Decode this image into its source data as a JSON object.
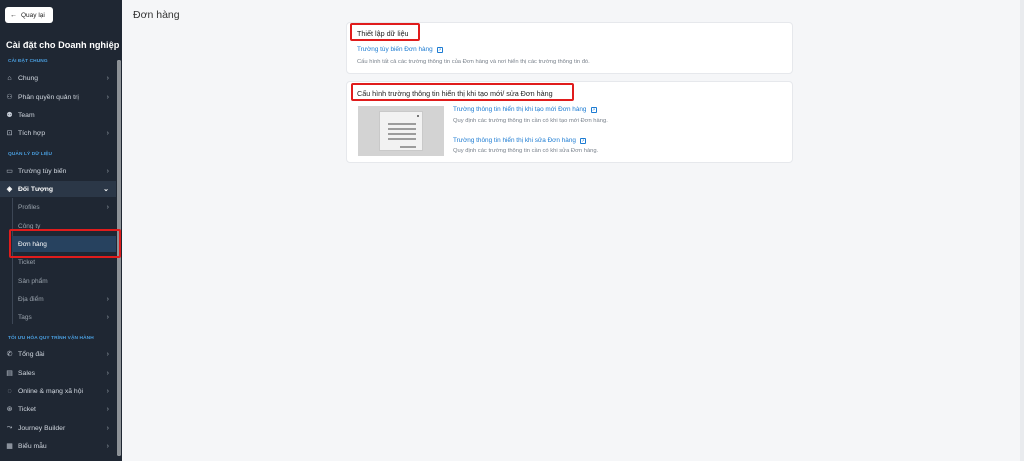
{
  "sidebar": {
    "back_label": "Quay lại",
    "title": "Cài đặt cho Doanh nghiệp",
    "section_general": "CÀI ĐẶT CHUNG",
    "section_data": "QUẢN LÝ DỮ LIỆU",
    "section_workflow": "TỐI ƯU HÓA QUY TRÌNH VẬN HÀNH",
    "items": {
      "chung": "Chung",
      "phan_quyen": "Phân quyền quản trị",
      "team": "Team",
      "tich_hop": "Tích hợp",
      "truong_tuy_bien": "Trường tùy biến",
      "doi_tuong": "Đối Tượng",
      "tong_dai": "Tổng đài",
      "sales": "Sales",
      "online": "Online & mạng xã hội",
      "ticket": "Ticket",
      "journey": "Journey Builder",
      "bieu_mau": "Biểu mẫu"
    },
    "sub_items": {
      "profiles": "Profiles",
      "cong_ty": "Công ty",
      "don_hang": "Đơn hàng",
      "ticket": "Ticket",
      "san_pham": "Sản phẩm",
      "dia_diem": "Địa điểm",
      "tags": "Tags"
    }
  },
  "main": {
    "page_title": "Đơn hàng",
    "card_setup": {
      "title": "Thiết lập dữ liệu",
      "link": "Trường tùy biến Đơn hàng",
      "description": "Cấu hình tất cả các trường thông tin của Đơn hàng và nơi hiển thị các trường thông tin đó."
    },
    "card_display": {
      "title": "Cấu hình trường thông tin hiển thị khi tạo mới/ sửa Đơn hàng",
      "create_link": "Trường thông tin hiển thị khi tạo mới Đơn hàng",
      "create_desc": "Quy định các trường thông tin cần có khi tạo mới Đơn hàng.",
      "edit_link": "Trường thông tin hiển thị khi sửa Đơn hàng",
      "edit_desc": "Quy định các trường thông tin cần có khi sửa Đơn hàng."
    }
  },
  "colors": {
    "sidebar_bg": "#1f2733",
    "accent_blue": "#1c7bd2",
    "highlight_red": "#e01c1c",
    "section_blue": "#4a9fe0"
  }
}
